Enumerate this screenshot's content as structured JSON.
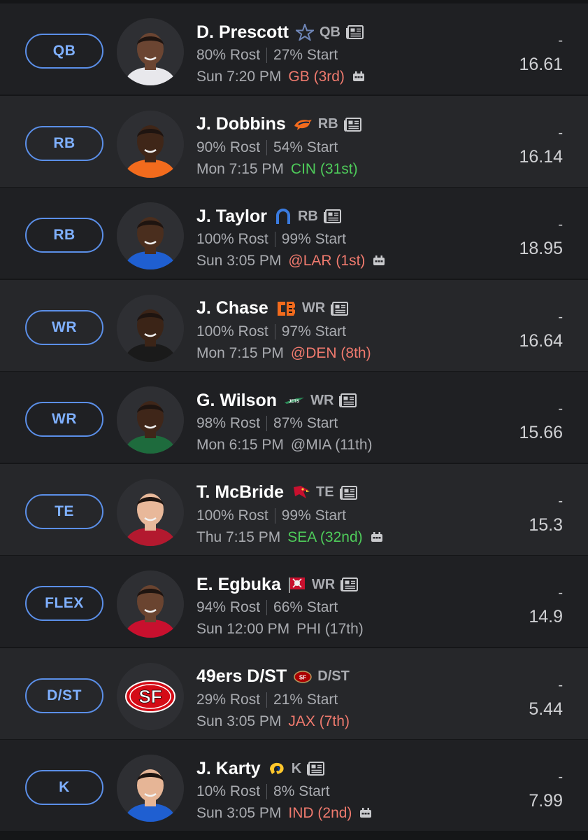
{
  "colors": {
    "accent": "#5b8fe8",
    "bad_matchup": "#f07a6e",
    "good_matchup": "#4ecb5a",
    "muted": "#a9abb0"
  },
  "roster": [
    {
      "slot": "QB",
      "name": "D. Prescott",
      "team_icon": "cowboys-star-icon",
      "position": "QB",
      "rost": "80% Rost",
      "start": "27% Start",
      "day_time": "Sun 7:20 PM",
      "opponent": "GB (3rd)",
      "matchup": "bad",
      "weather_icon": true,
      "dash": "-",
      "projection": "16.61",
      "jersey": "#e8e8ec",
      "skin": "#6b4532"
    },
    {
      "slot": "RB",
      "name": "J. Dobbins",
      "team_icon": "broncos-icon",
      "position": "RB",
      "rost": "90% Rost",
      "start": "54% Start",
      "day_time": "Mon 7:15 PM",
      "opponent": "CIN (31st)",
      "matchup": "good",
      "weather_icon": false,
      "dash": "-",
      "projection": "16.14",
      "jersey": "#f26b1d",
      "skin": "#3f2618"
    },
    {
      "slot": "RB",
      "name": "J. Taylor",
      "team_icon": "colts-horseshoe-icon",
      "position": "RB",
      "rost": "100% Rost",
      "start": "99% Start",
      "day_time": "Sun 3:05 PM",
      "opponent": "@LAR (1st)",
      "matchup": "bad",
      "weather_icon": true,
      "dash": "-",
      "projection": "18.95",
      "jersey": "#1f5fd1",
      "skin": "#4a2e1e"
    },
    {
      "slot": "WR",
      "name": "J. Chase",
      "team_icon": "bengals-icon",
      "position": "WR",
      "rost": "100% Rost",
      "start": "97% Start",
      "day_time": "Mon 7:15 PM",
      "opponent": "@DEN (8th)",
      "matchup": "bad",
      "weather_icon": false,
      "dash": "-",
      "projection": "16.64",
      "jersey": "#1a1a1a",
      "skin": "#3b2417"
    },
    {
      "slot": "WR",
      "name": "G. Wilson",
      "team_icon": "jets-icon",
      "position": "WR",
      "rost": "98% Rost",
      "start": "87% Start",
      "day_time": "Mon 6:15 PM",
      "opponent": "@MIA (11th)",
      "matchup": "neutral",
      "weather_icon": false,
      "dash": "-",
      "projection": "15.66",
      "jersey": "#1e6b3d",
      "skin": "#3f2619"
    },
    {
      "slot": "TE",
      "name": "T. McBride",
      "team_icon": "cardinals-icon",
      "position": "TE",
      "rost": "100% Rost",
      "start": "99% Start",
      "day_time": "Thu 7:15 PM",
      "opponent": "SEA (32nd)",
      "matchup": "good",
      "weather_icon": true,
      "dash": "-",
      "projection": "15.3",
      "jersey": "#b3192f",
      "skin": "#e8b89a"
    },
    {
      "slot": "FLEX",
      "name": "E. Egbuka",
      "team_icon": "buccaneers-flag-icon",
      "position": "WR",
      "rost": "94% Rost",
      "start": "66% Start",
      "day_time": "Sun 12:00 PM",
      "opponent": "PHI (17th)",
      "matchup": "neutral",
      "weather_icon": false,
      "dash": "-",
      "projection": "14.9",
      "jersey": "#c8102e",
      "skin": "#6a4430"
    },
    {
      "slot": "D/ST",
      "name": "49ers D/ST",
      "team_icon": "49ers-icon",
      "position": "D/ST",
      "rost": "29% Rost",
      "start": "21% Start",
      "day_time": "Sun 3:05 PM",
      "opponent": "JAX (7th)",
      "matchup": "bad",
      "weather_icon": false,
      "dash": "-",
      "projection": "5.44",
      "jersey": "",
      "skin": ""
    },
    {
      "slot": "K",
      "name": "J. Karty",
      "team_icon": "rams-icon",
      "position": "K",
      "rost": "10% Rost",
      "start": "8% Start",
      "day_time": "Sun 3:05 PM",
      "opponent": "IND (2nd)",
      "matchup": "bad",
      "weather_icon": true,
      "dash": "-",
      "projection": "7.99",
      "jersey": "#1f5fd1",
      "skin": "#e6b596"
    }
  ]
}
